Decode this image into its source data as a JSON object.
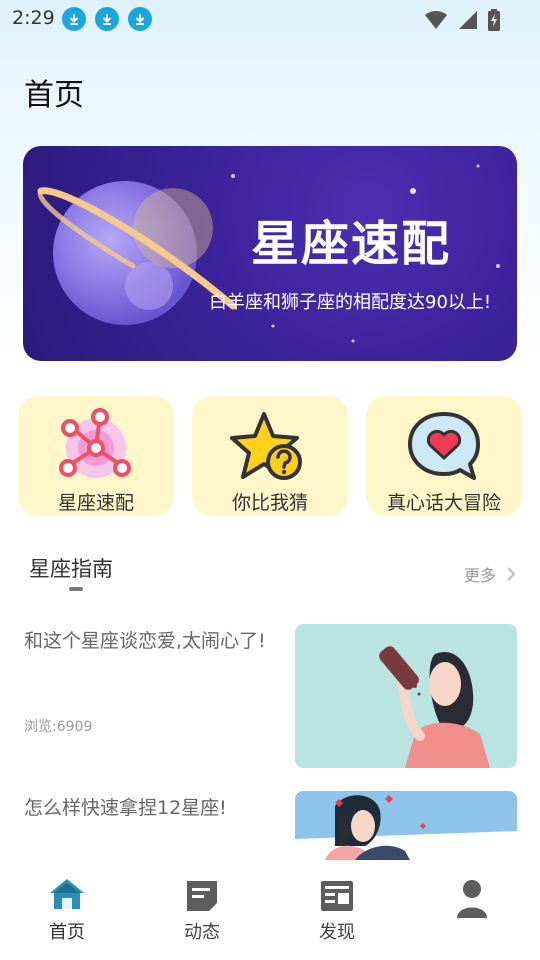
{
  "status_bar": {
    "time": "2:29",
    "download_icons": [
      "download-icon",
      "download-icon",
      "download-icon"
    ],
    "right_icons": [
      "wifi-icon",
      "signal-icon",
      "battery-icon"
    ]
  },
  "header": {
    "title": "首页"
  },
  "banner": {
    "title": "星座速配",
    "subtitle": "白羊座和狮子座的相配度达90以上!",
    "colors": {
      "bg": "#3b239a",
      "planet": "#8f7ce6",
      "ring": "#f5c98a"
    }
  },
  "features": [
    {
      "label": "星座速配",
      "icon": "constellation-network-icon"
    },
    {
      "label": "你比我猜",
      "icon": "star-question-icon"
    },
    {
      "label": "真心话大冒险",
      "icon": "heart-chat-icon"
    }
  ],
  "guide": {
    "title": "星座指南",
    "more_label": "更多"
  },
  "articles": [
    {
      "title": "和这个星座谈恋爱,太闹心了!",
      "views": "浏览:6909"
    },
    {
      "title": "怎么样快速拿捏12星座!",
      "views": ""
    }
  ],
  "bottom_nav": [
    {
      "label": "首页",
      "icon": "home-icon",
      "active": true
    },
    {
      "label": "动态",
      "icon": "feed-icon",
      "active": false
    },
    {
      "label": "发现",
      "icon": "discover-icon",
      "active": false
    },
    {
      "label": "",
      "icon": "profile-icon",
      "active": false
    }
  ],
  "colors": {
    "accent": "#1aa6e0",
    "card_bg": "#fff7c9",
    "nav_active": "#2a8fb5",
    "nav_inactive": "#5d5d5d"
  }
}
